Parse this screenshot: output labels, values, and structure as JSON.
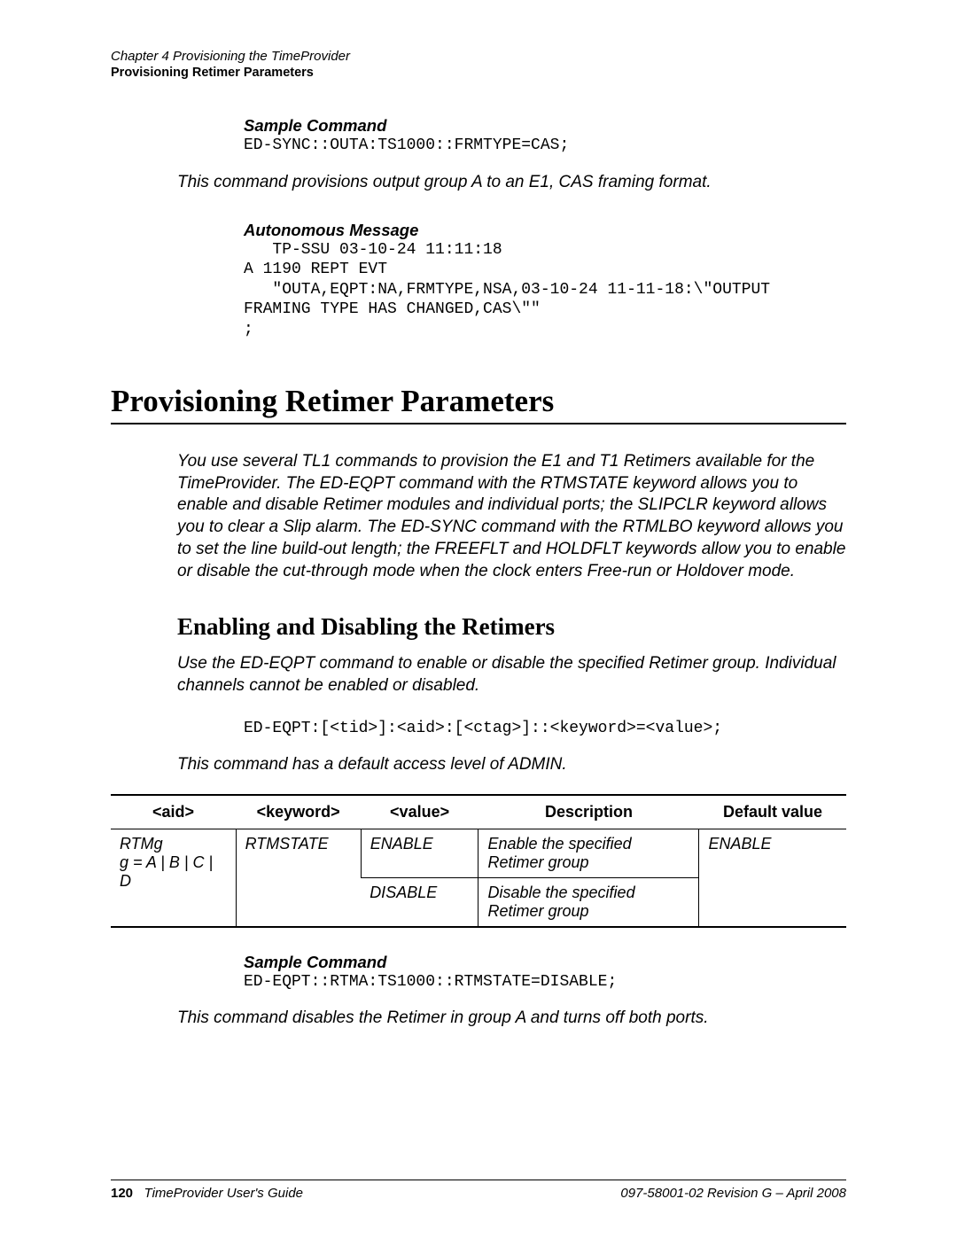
{
  "header": {
    "chapter_line": "Chapter 4 Provisioning the TimeProvider",
    "section_line": "Provisioning Retimer Parameters"
  },
  "sample1": {
    "heading": "Sample Command",
    "code": "ED-SYNC::OUTA:TS1000::FRMTYPE=CAS;",
    "explain": "This command provisions output group A to an E1, CAS framing format."
  },
  "autonomous": {
    "heading": "Autonomous Message",
    "code": "   TP-SSU 03-10-24 11:11:18\nA 1190 REPT EVT\n   \"OUTA,EQPT:NA,FRMTYPE,NSA,03-10-24 11-11-18:\\\"OUTPUT\nFRAMING TYPE HAS CHANGED,CAS\\\"\"\n;"
  },
  "main": {
    "h1": "Provisioning Retimer Parameters",
    "intro": "You use several TL1 commands to provision the E1 and T1 Retimers available for the TimeProvider. The ED-EQPT command with the RTMSTATE keyword allows you to enable and disable Retimer modules and individual ports; the SLIPCLR keyword allows you to clear a Slip alarm. The ED-SYNC command with the RTMLBO keyword allows you to set the line build-out length; the FREEFLT and HOLDFLT keywords allow you to enable or disable the cut-through mode when the clock enters Free-run or Holdover mode.",
    "h2": "Enabling and Disabling the Retimers",
    "p1": "Use the ED-EQPT command to enable or disable the specified Retimer group. Individual channels cannot be enabled or disabled.",
    "syntax": "ED-EQPT:[<tid>]:<aid>:[<ctag>]::<keyword>=<value>;",
    "p2": "This command has a default access level of ADMIN."
  },
  "table": {
    "headers": {
      "aid": "<aid>",
      "keyword": "<keyword>",
      "value": "<value>",
      "description": "Description",
      "default": "Default value"
    },
    "col_aid_line1": "RTMg",
    "col_aid_line2": "g = A | B | C | D",
    "col_keyword": "RTMSTATE",
    "col_value_1": "ENABLE",
    "col_desc_1": "Enable the specified Retimer group",
    "col_default": "ENABLE",
    "col_value_2": "DISABLE",
    "col_desc_2": "Disable the specified Retimer group"
  },
  "sample2": {
    "heading": "Sample Command",
    "code": "ED-EQPT::RTMA:TS1000::RTMSTATE=DISABLE;",
    "explain": "This command disables the Retimer in group A and turns off both ports."
  },
  "footer": {
    "page": "120",
    "left": "TimeProvider User's Guide",
    "right": "097-58001-02 Revision G – April 2008"
  }
}
